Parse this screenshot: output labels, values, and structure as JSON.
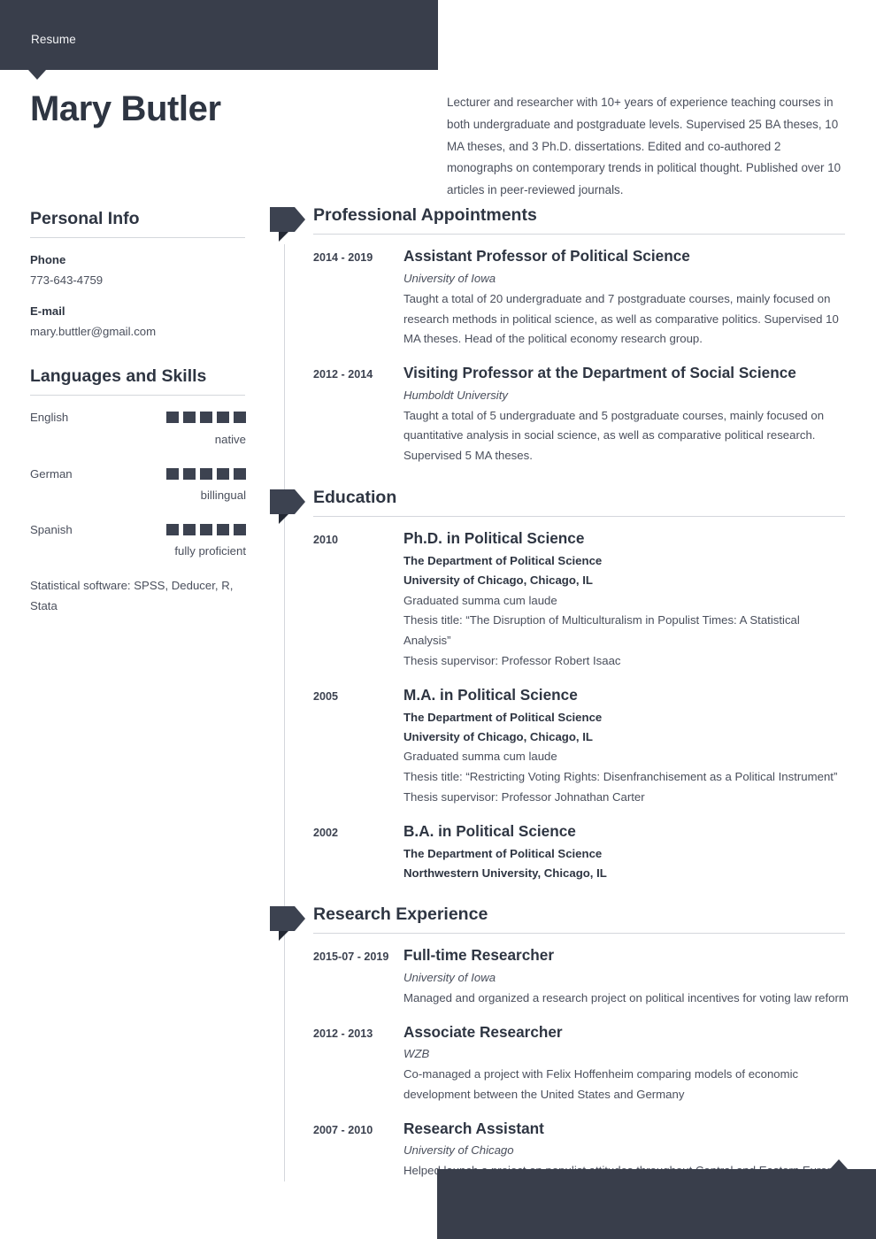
{
  "header": {
    "label": "Resume",
    "accent_color": "#393e4b"
  },
  "name": "Mary Butler",
  "summary": "Lecturer and researcher with 10+ years of experience teaching courses in both undergraduate and postgraduate levels. Supervised 25 BA theses, 10 MA theses, and 3 Ph.D. dissertations. Edited and co-authored 2 monographs on contemporary trends in political thought. Published over 10 articles in peer-reviewed journals.",
  "sidebar": {
    "personal_info": {
      "heading": "Personal Info",
      "phone_label": "Phone",
      "phone_value": "773-643-4759",
      "email_label": "E-mail",
      "email_value": "mary.buttler@gmail.com"
    },
    "languages_skills": {
      "heading": "Languages and Skills",
      "languages": [
        {
          "name": "English",
          "filled": 5,
          "total": 5,
          "level": "native"
        },
        {
          "name": "German",
          "filled": 5,
          "total": 5,
          "level": "billingual"
        },
        {
          "name": "Spanish",
          "filled": 5,
          "total": 5,
          "level": "fully proficient"
        }
      ],
      "software": "Statistical software: SPSS, Deducer, R, Stata"
    }
  },
  "sections": [
    {
      "title": "Professional Appointments",
      "entries": [
        {
          "date": "2014 - 2019",
          "title": "Assistant Professor of Political Science",
          "org_italic": "University of Iowa",
          "org_bold": [],
          "desc": [
            "Taught a total of 20 undergraduate and 7 postgraduate courses, mainly focused on research methods in political science, as well as comparative politics. Supervised 10 MA theses. Head of the political economy research group."
          ]
        },
        {
          "date": "2012 - 2014",
          "title": "Visiting Professor at the Department of Social Science",
          "org_italic": "Humboldt University",
          "org_bold": [],
          "desc": [
            "Taught a total of 5 undergraduate and 5 postgraduate courses, mainly focused on quantitative analysis in social science, as well as comparative political research. Supervised 5 MA theses."
          ]
        }
      ]
    },
    {
      "title": "Education",
      "entries": [
        {
          "date": "2010",
          "title": "Ph.D. in Political Science",
          "org_italic": "",
          "org_bold": [
            "The Department of Political Science",
            "University of Chicago, Chicago, IL"
          ],
          "desc": [
            "Graduated summa cum laude",
            "Thesis title: “The Disruption of Multiculturalism in Populist Times: A Statistical Analysis”",
            "Thesis supervisor: Professor Robert Isaac"
          ]
        },
        {
          "date": "2005",
          "title": "M.A. in Political Science",
          "org_italic": "",
          "org_bold": [
            "The Department of Political Science",
            "University of Chicago, Chicago, IL"
          ],
          "desc": [
            "Graduated summa cum laude",
            "Thesis title: “Restricting Voting Rights: Disenfranchisement as a Political Instrument”",
            "Thesis supervisor: Professor Johnathan Carter"
          ]
        },
        {
          "date": "2002",
          "title": "B.A. in Political Science",
          "org_italic": "",
          "org_bold": [
            "The Department of Political Science",
            "Northwestern University, Chicago, IL"
          ],
          "desc": []
        }
      ]
    },
    {
      "title": "Research Experience",
      "entries": [
        {
          "date": "2015-07 - 2019",
          "title": "Full-time Researcher",
          "org_italic": "University of Iowa",
          "org_bold": [],
          "desc": [
            "Managed and organized a research project on political incentives for voting law reform"
          ]
        },
        {
          "date": "2012 - 2013",
          "title": "Associate Researcher",
          "org_italic": "WZB",
          "org_bold": [],
          "desc": [
            "Co-managed a project with Felix Hoffenheim comparing models of economic development between the United States and Germany"
          ]
        },
        {
          "date": "2007 - 2010",
          "title": "Research Assistant",
          "org_italic": "University of Chicago",
          "org_bold": [],
          "desc": [
            "Helped launch a project on populist attitudes throughout Central and Eastern Europe"
          ]
        }
      ]
    }
  ]
}
